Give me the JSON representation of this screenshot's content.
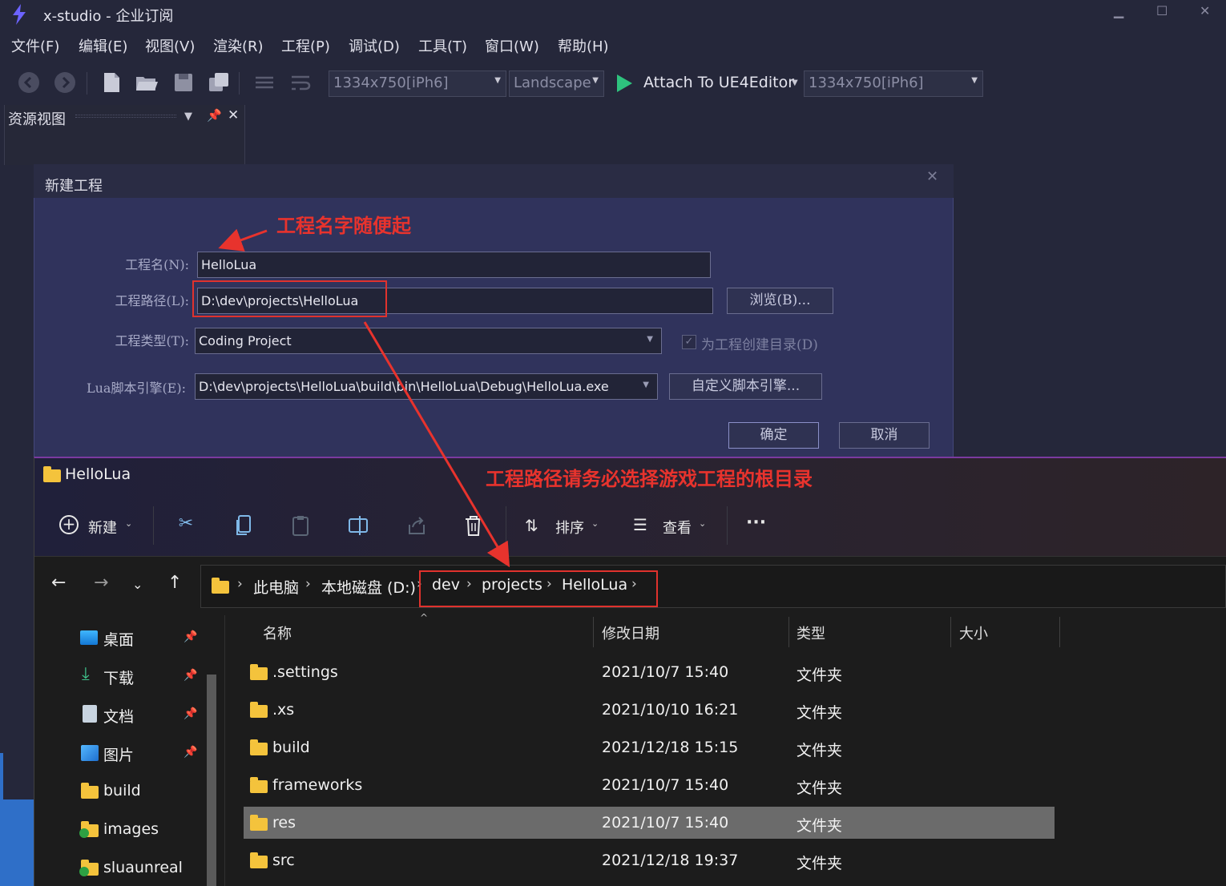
{
  "app": {
    "title": "x-studio - 企业订阅"
  },
  "window_controls": {
    "minimize": "▁",
    "maximize": "☐",
    "close": "✕"
  },
  "menu": [
    "文件(F)",
    "编辑(E)",
    "视图(V)",
    "渲染(R)",
    "工程(P)",
    "调试(D)",
    "工具(T)",
    "窗口(W)",
    "帮助(H)"
  ],
  "toolbar": {
    "resolution": "1334x750[iPh6]",
    "orientation": "Landscape",
    "attach_label": "Attach To UE4Editor",
    "resolution2": "1334x750[iPh6]"
  },
  "resource_panel": {
    "title": "资源视图"
  },
  "dialog": {
    "title": "新建工程",
    "close": "✕",
    "name_label": "工程名(N):",
    "name_value": "HelloLua",
    "path_label": "工程路径(L):",
    "path_value": "D:\\dev\\projects\\HelloLua",
    "browse_label": "浏览(B)...",
    "type_label": "工程类型(T):",
    "type_value": "Coding Project",
    "create_dir_label": "为工程创建目录(D)",
    "engine_label": "Lua脚本引擎(E):",
    "engine_value": "D:\\dev\\projects\\HelloLua\\build\\bin\\HelloLua\\Debug\\HelloLua.exe",
    "custom_engine_label": "自定义脚本引擎...",
    "ok_label": "确定",
    "cancel_label": "取消"
  },
  "annotations": {
    "name_note": "工程名字随便起",
    "path_note": "工程路径请务必选择游戏工程的根目录"
  },
  "explorer": {
    "title": "HelloLua",
    "toolbar": {
      "new_label": "新建",
      "sort_label": "排序",
      "view_label": "查看",
      "more_label": "···"
    },
    "breadcrumb": [
      "此电脑",
      "本地磁盘 (D:)",
      "dev",
      "projects",
      "HelloLua"
    ],
    "nav_items": [
      {
        "label": "桌面",
        "icon": "desktop-icon",
        "pinned": true
      },
      {
        "label": "下载",
        "icon": "download-icon",
        "pinned": true
      },
      {
        "label": "文档",
        "icon": "document-icon",
        "pinned": true
      },
      {
        "label": "图片",
        "icon": "picture-icon",
        "pinned": true
      },
      {
        "label": "build",
        "icon": "folder-icon",
        "pinned": false
      },
      {
        "label": "images",
        "icon": "synced-folder-icon",
        "pinned": false
      },
      {
        "label": "sluaunreal",
        "icon": "synced-folder-icon",
        "pinned": false
      }
    ],
    "columns": {
      "name": "名称",
      "date": "修改日期",
      "type": "类型",
      "size": "大小"
    },
    "files": [
      {
        "name": ".settings",
        "date": "2021/10/7 15:40",
        "type": "文件夹",
        "selected": false
      },
      {
        "name": ".xs",
        "date": "2021/10/10 16:21",
        "type": "文件夹",
        "selected": false
      },
      {
        "name": "build",
        "date": "2021/12/18 15:15",
        "type": "文件夹",
        "selected": false
      },
      {
        "name": "frameworks",
        "date": "2021/10/7 15:40",
        "type": "文件夹",
        "selected": false
      },
      {
        "name": "res",
        "date": "2021/10/7 15:40",
        "type": "文件夹",
        "selected": true
      },
      {
        "name": "src",
        "date": "2021/12/18 19:37",
        "type": "文件夹",
        "selected": false
      }
    ]
  },
  "colors": {
    "accent_red": "#e8332d",
    "folder_yellow": "#f4c33c",
    "play_green": "#2ec27e"
  }
}
